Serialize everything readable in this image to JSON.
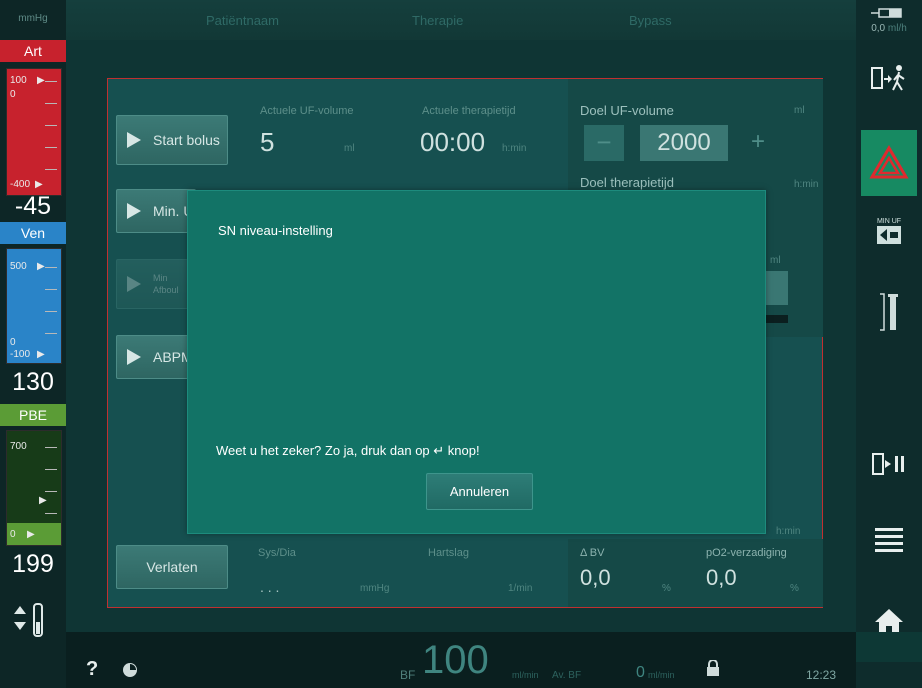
{
  "header": {
    "patient_name": "Patiëntnaam",
    "therapy": "Therapie",
    "bypass": "Bypass",
    "unit": "mmHg"
  },
  "pressures": {
    "art": {
      "label": "Art",
      "top_scale": "100",
      "zero": "0",
      "bottom_scale": "-400",
      "value": "-45",
      "color": "#c7222d"
    },
    "ven": {
      "label": "Ven",
      "top_scale": "500",
      "zero": "0",
      "bottom_scale": "-100",
      "value": "130",
      "color": "#2a84c8"
    },
    "pbe": {
      "label": "PBE",
      "top_scale": "700",
      "zero": "0",
      "value": "199",
      "color": "#5b9c36"
    }
  },
  "panel": {
    "start_bolus": "Start bolus",
    "min_uf": "Min. U",
    "min_uf_disabled": "Min",
    "min_uf_disabled2": "Afboul",
    "abpm": "ABPM",
    "leave": "Verlaten",
    "current_uf_label": "Actuele UF-volume",
    "current_uf_value": "5",
    "current_uf_unit": "ml",
    "current_time_label": "Actuele therapietijd",
    "current_time_value": "00:00",
    "current_time_unit": "h:min",
    "target_uf_label": "Doel UF-volume",
    "target_uf_unit": "ml",
    "target_uf_value": "2000",
    "minus": "−",
    "plus": "+",
    "target_time_label": "Doel therapietijd",
    "target_time_unit": "h:min",
    "side_unit": "ml",
    "side_unit2": "h:min",
    "sysdia_label": "Sys/Dia",
    "sysdia_value": ". . .",
    "sysdia_unit": "mmHg",
    "hr_label": "Hartslag",
    "hr_unit": "1/min",
    "dbv_label": "Δ BV",
    "dbv_value": "0,0",
    "dbv_unit": "%",
    "po2_label": "pO2-verzadiging",
    "po2_value": "0,0",
    "po2_unit": "%"
  },
  "modal": {
    "title": "SN niveau-instelling",
    "message": "Weet u het zeker? Zo ja, druk dan op ↵ knop!",
    "cancel": "Annuleren"
  },
  "right": {
    "top_reading": "0,0",
    "top_unit": "ml/h",
    "min_uf": "MIN UF"
  },
  "bottom": {
    "help": "?",
    "bf_label": "BF",
    "bf_value": "100",
    "bf_unit": "ml/min",
    "avbf_label": "Av. BF",
    "avbf_value": "0",
    "avbf_unit": "ml/min",
    "time": "12:23"
  }
}
